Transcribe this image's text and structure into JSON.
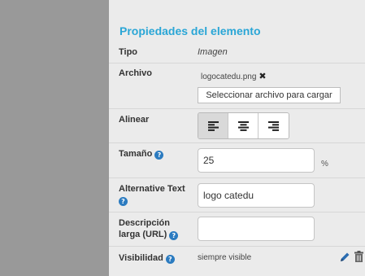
{
  "panel": {
    "title": "Propiedades del elemento"
  },
  "rows": {
    "tipo": {
      "label": "Tipo",
      "value": "Imagen"
    },
    "archivo": {
      "label": "Archivo",
      "file_name": "logocatedu.png",
      "remove_glyph": "✖",
      "button_label": "Seleccionar archivo para cargar"
    },
    "alinear": {
      "label": "Alinear",
      "options": [
        "left",
        "center",
        "right"
      ],
      "selected": "left"
    },
    "tamano": {
      "label": "Tamaño",
      "value": "25",
      "unit": "%"
    },
    "alt_text": {
      "label_line1": "Alternative Text",
      "value": "logo catedu"
    },
    "descripcion": {
      "label_line1": "Descripción",
      "label_line2": "larga (URL)",
      "value": ""
    },
    "visibilidad": {
      "label": "Visibilidad",
      "value": "siempre visible"
    }
  },
  "icons": {
    "help": "question-circle-icon",
    "remove": "close-icon",
    "edit": "pencil-icon",
    "delete": "trash-icon"
  },
  "colors": {
    "title": "#2aa6d6",
    "help_icon": "#2b7bc0",
    "edit_icon": "#2b6cb0",
    "panel_bg": "#ebebeb",
    "left_gray": "#999999"
  }
}
